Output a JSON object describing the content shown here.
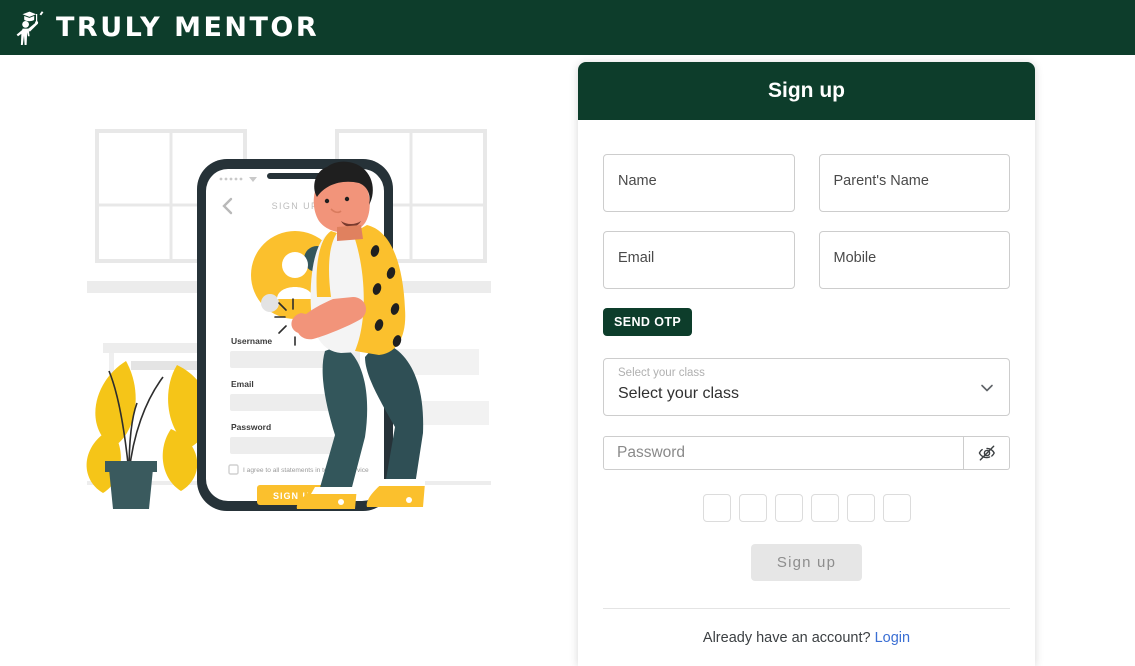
{
  "topbar": {
    "brand": "Truly Mentor",
    "logo_icon": "graduate-figure-icon"
  },
  "illustration": {
    "alt": "person-signing-up-on-phone-illustration",
    "phone_screen": {
      "title": "SIGN UP",
      "back_icon": "chevron-left-icon",
      "fields": [
        "Username",
        "Email",
        "Password"
      ],
      "terms_text": "I agree to all statements in terms of service",
      "submit_label": "SIGN UP"
    },
    "colors": {
      "accent_yellow": "#FBC02D",
      "dark_teal": "#2C4A52",
      "skin": "#F2947A",
      "phone_frame": "#263238"
    }
  },
  "card": {
    "title": "Sign up",
    "header_color": "#0D3D2B",
    "fields": [
      {
        "name": "name",
        "label": "Name",
        "value": ""
      },
      {
        "name": "parents_name",
        "label": "Parent's Name",
        "value": ""
      },
      {
        "name": "email",
        "label": "Email",
        "value": ""
      },
      {
        "name": "mobile",
        "label": "Mobile",
        "value": ""
      }
    ],
    "send_otp_label": "SEND OTP",
    "class_select": {
      "floating_label": "Select your class",
      "selected_value": "Select your class",
      "chevron_icon": "chevron-down-icon"
    },
    "password": {
      "placeholder": "Password",
      "value": "",
      "toggle_icon": "eye-off-icon"
    },
    "otp": {
      "digit_count": 6,
      "digits": [
        "",
        "",
        "",
        "",
        "",
        ""
      ]
    },
    "submit_label": "Sign up",
    "footer": {
      "prompt": "Already have an account?",
      "link_label": "Login",
      "link_color": "#3B6FD4"
    }
  }
}
